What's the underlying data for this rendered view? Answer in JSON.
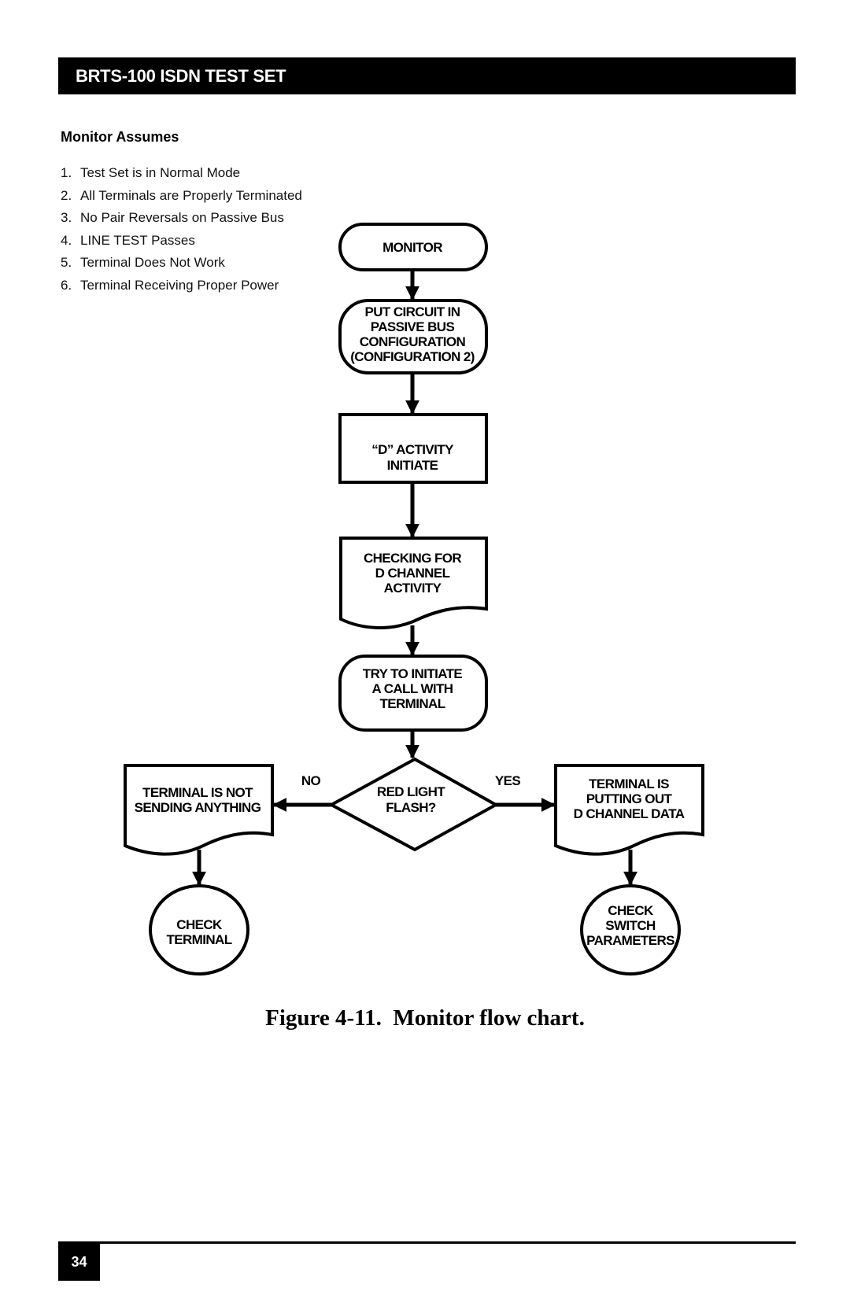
{
  "header": {
    "title": "BRTS-100 ISDN TEST SET"
  },
  "assumptions": {
    "title": "Monitor Assumes",
    "items": [
      {
        "num": "1.",
        "text": "Test Set is in Normal Mode"
      },
      {
        "num": "2.",
        "text": "All Terminals are Properly Terminated"
      },
      {
        "num": "3.",
        "text": "No Pair Reversals on Passive Bus"
      },
      {
        "num": "4.",
        "text": "LINE TEST Passes"
      },
      {
        "num": "5.",
        "text": "Terminal Does Not Work"
      },
      {
        "num": "6.",
        "text": "Terminal Receiving Proper Power"
      }
    ]
  },
  "flowchart": {
    "nodes": {
      "monitor": {
        "shape": "terminator",
        "lines": [
          "MONITOR"
        ]
      },
      "passive_bus": {
        "shape": "terminator",
        "lines": [
          "PUT CIRCUIT IN",
          "PASSIVE BUS",
          "CONFIGURATION",
          "(CONFIGURATION 2)"
        ]
      },
      "d_activity": {
        "shape": "process",
        "lines": [
          "“D” ACTIVITY",
          "INITIATE"
        ]
      },
      "checking": {
        "shape": "document",
        "lines": [
          "CHECKING FOR",
          "D CHANNEL",
          "ACTIVITY"
        ]
      },
      "try_call": {
        "shape": "terminator",
        "lines": [
          "TRY TO INITIATE",
          "A CALL WITH",
          "TERMINAL"
        ]
      },
      "red_light": {
        "shape": "decision",
        "lines": [
          "RED LIGHT",
          "FLASH?"
        ]
      },
      "not_sending": {
        "shape": "document",
        "lines": [
          "TERMINAL IS NOT",
          "SENDING ANYTHING"
        ]
      },
      "putting_out": {
        "shape": "document",
        "lines": [
          "TERMINAL IS",
          "PUTTING OUT",
          "D CHANNEL DATA"
        ]
      },
      "check_terminal": {
        "shape": "ellipse",
        "lines": [
          "CHECK",
          "TERMINAL"
        ]
      },
      "check_switch": {
        "shape": "ellipse",
        "lines": [
          "CHECK",
          "SWITCH",
          "PARAMETERS"
        ]
      }
    },
    "edges": [
      {
        "from": "monitor",
        "to": "passive_bus",
        "label": ""
      },
      {
        "from": "passive_bus",
        "to": "d_activity",
        "label": ""
      },
      {
        "from": "d_activity",
        "to": "checking",
        "label": ""
      },
      {
        "from": "checking",
        "to": "try_call",
        "label": ""
      },
      {
        "from": "try_call",
        "to": "red_light",
        "label": ""
      },
      {
        "from": "red_light",
        "to": "not_sending",
        "label": "NO"
      },
      {
        "from": "red_light",
        "to": "putting_out",
        "label": "YES"
      },
      {
        "from": "not_sending",
        "to": "check_terminal",
        "label": ""
      },
      {
        "from": "putting_out",
        "to": "check_switch",
        "label": ""
      }
    ]
  },
  "caption": "Figure 4-11.  Monitor flow chart.",
  "footer": {
    "page_number": "34"
  }
}
